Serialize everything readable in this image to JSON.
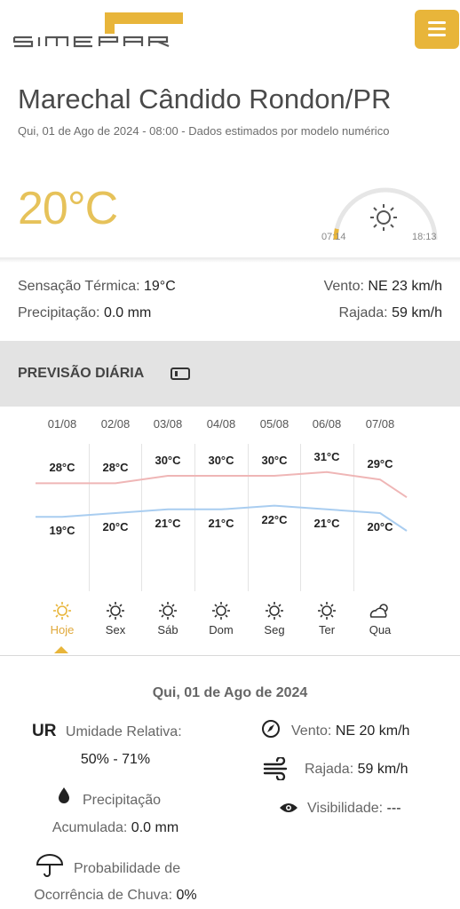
{
  "header": {
    "logo_text": "SIMEPAR",
    "menu_icon": "hamburger-icon",
    "brand_color": "#e8b53a"
  },
  "location": {
    "city": "Marechal Cândido Rondon/PR",
    "subtitle": "Qui, 01 de Ago de 2024 - 08:00 - Dados estimados por modelo numérico"
  },
  "current": {
    "temperature": "20°C",
    "sunrise": "07:14",
    "sunset": "18:13",
    "sun_icon": "sun-icon",
    "day_progress": 0.07
  },
  "stats": {
    "feels_like_label": "Sensação Térmica:",
    "feels_like_value": "19°C",
    "wind_label": "Vento:",
    "wind_value": "NE 23 km/h",
    "precip_label": "Precipitação:",
    "precip_value": "0.0 mm",
    "gust_label": "Rajada:",
    "gust_value": "59 km/h"
  },
  "forecast": {
    "title": "PREVISÃO DIÁRIA",
    "toggle_icon": "rotate-device-icon",
    "days": [
      {
        "date": "01/08",
        "max": "28°C",
        "min": "19°C",
        "name": "Hoje",
        "icon": "sun-icon",
        "selected": true
      },
      {
        "date": "02/08",
        "max": "28°C",
        "min": "20°C",
        "name": "Sex",
        "icon": "sun-icon",
        "selected": false
      },
      {
        "date": "03/08",
        "max": "30°C",
        "min": "21°C",
        "name": "Sáb",
        "icon": "sun-icon",
        "selected": false
      },
      {
        "date": "04/08",
        "max": "30°C",
        "min": "21°C",
        "name": "Dom",
        "icon": "sun-icon",
        "selected": false
      },
      {
        "date": "05/08",
        "max": "30°C",
        "min": "22°C",
        "name": "Seg",
        "icon": "sun-icon",
        "selected": false
      },
      {
        "date": "06/08",
        "max": "31°C",
        "min": "21°C",
        "name": "Ter",
        "icon": "sun-icon",
        "selected": false
      },
      {
        "date": "07/08",
        "max": "29°C",
        "min": "20°C",
        "name": "Qua",
        "icon": "partly-cloudy-icon",
        "selected": false
      }
    ],
    "max_color": "#efb6b6",
    "min_color": "#a9cdf0"
  },
  "details": {
    "date": "Qui, 01 de Ago de 2024",
    "ur_abbr": "UR",
    "humidity_label": "Umidade Relativa:",
    "humidity_value": "50% - 71%",
    "precip_label_1": "Precipitação",
    "precip_label_2": "Acumulada:",
    "precip_value": "0.0 mm",
    "rain_prob_label_1": "Probabilidade de",
    "rain_prob_label_2": "Ocorrência de Chuva:",
    "rain_prob_value": "0%",
    "wind_label": "Vento:",
    "wind_value": "NE 20 km/h",
    "gust_label": "Rajada:",
    "gust_value": "59 km/h",
    "visibility_label": "Visibilidade:",
    "visibility_value": "---"
  }
}
